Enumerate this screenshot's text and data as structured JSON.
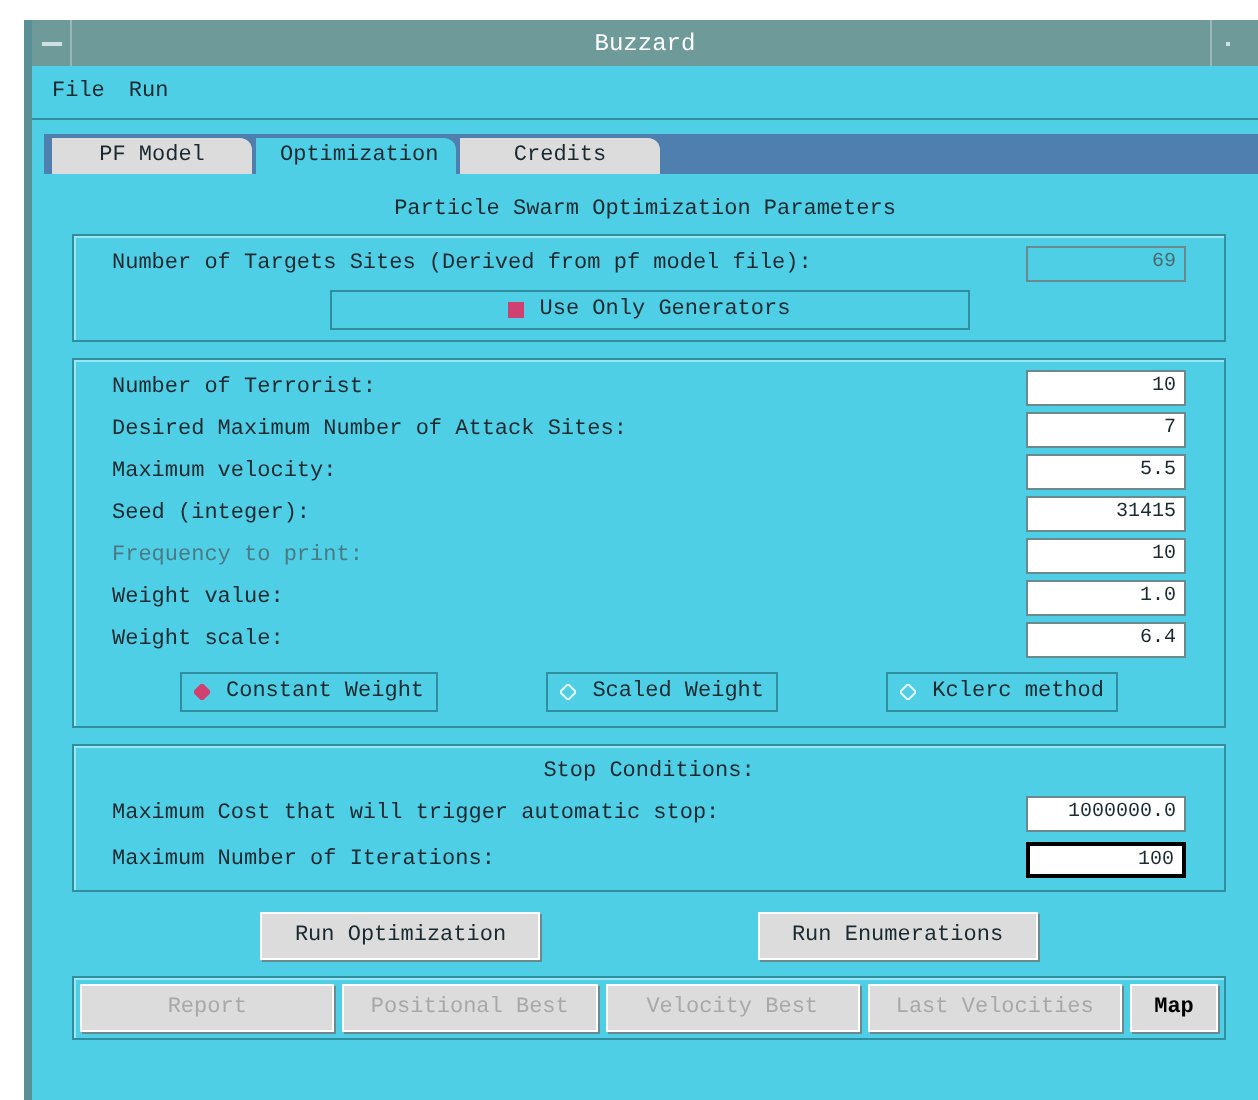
{
  "window": {
    "title": "Buzzard"
  },
  "menu": [
    "File",
    "Run"
  ],
  "tabs": [
    {
      "label": "PF Model",
      "selected": false
    },
    {
      "label": "Optimization",
      "selected": true
    },
    {
      "label": "Credits",
      "selected": false
    }
  ],
  "heading": "Particle Swarm Optimization Parameters",
  "targets": {
    "label": "Number of Targets Sites (Derived from pf model file):",
    "value": "69",
    "disabled": true,
    "checkbox": {
      "label": "Use Only Generators",
      "checked": true
    }
  },
  "parameters": [
    {
      "label": "Number of Terrorist:",
      "value": "10",
      "disabled": false
    },
    {
      "label": "Desired Maximum Number of Attack Sites:",
      "value": "7",
      "disabled": false
    },
    {
      "label": "Maximum velocity:",
      "value": "5.5",
      "disabled": false
    },
    {
      "label": "Seed (integer):",
      "value": "31415",
      "disabled": false
    },
    {
      "label": "Frequency to print:",
      "value": "10",
      "disabled": true
    },
    {
      "label": "Weight value:",
      "value": "1.0",
      "disabled": false
    },
    {
      "label": "Weight scale:",
      "value": "6.4",
      "disabled": false
    }
  ],
  "weight_modes": [
    {
      "label": "Constant Weight",
      "selected": true
    },
    {
      "label": "Scaled Weight",
      "selected": false
    },
    {
      "label": "Kclerc method",
      "selected": false
    }
  ],
  "stop_conditions": {
    "title": "Stop Conditions:",
    "fields": [
      {
        "label": "Maximum Cost that will trigger automatic stop:",
        "value": "1000000.0",
        "focused": false
      },
      {
        "label": "Maximum Number of Iterations:",
        "value": "100",
        "focused": true
      }
    ]
  },
  "run_buttons": [
    "Run Optimization",
    "Run Enumerations"
  ],
  "output_buttons": [
    {
      "label": "Report",
      "disabled": true
    },
    {
      "label": "Positional Best",
      "disabled": true
    },
    {
      "label": "Velocity Best",
      "disabled": true
    },
    {
      "label": "Last Velocities",
      "disabled": true
    },
    {
      "label": "Map",
      "disabled": false
    }
  ]
}
